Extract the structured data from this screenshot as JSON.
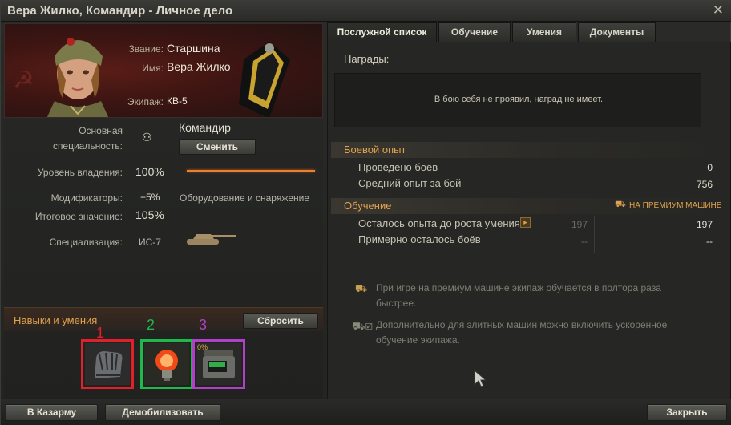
{
  "window": {
    "title": "Вера Жилко, Командир - Личное дело",
    "close_glyph": "✕"
  },
  "profile": {
    "rank_label": "Звание:",
    "rank_value": "Старшина",
    "name_label": "Имя:",
    "name_value": "Вера Жилко",
    "crew_label": "Экипаж:",
    "crew_value": "КВ-5"
  },
  "specialty": {
    "label_line1": "Основная",
    "label_line2": "специальность:",
    "value": "Командир",
    "change_button": "Сменить",
    "icon": "binoculars-icon"
  },
  "mastery": {
    "label": "Уровень владения:",
    "value": "100%",
    "progress": 1.0,
    "bar_color": "#e7822f"
  },
  "modifiers": {
    "label": "Модификаторы:",
    "value": "+5%",
    "source": "Оборудование и снаряжение"
  },
  "total": {
    "label": "Итоговое значение:",
    "value": "105%"
  },
  "specialization": {
    "label": "Специализация:",
    "value": "ИС-7",
    "icon": "tank-silhouette-icon"
  },
  "skills": {
    "title": "Навыки и умения",
    "reset_button": "Сбросить",
    "slots": [
      {
        "number": "1",
        "icon": "gauntlet-icon",
        "border": "#e0202a",
        "badge": ""
      },
      {
        "number": "2",
        "icon": "lightbulb-icon",
        "border": "#1fb84a",
        "badge": ""
      },
      {
        "number": "3",
        "icon": "radio-device-icon",
        "border": "#b040c8",
        "badge": "0%"
      }
    ]
  },
  "tabs": [
    "Послужной список",
    "Обучение",
    "Умения",
    "Документы"
  ],
  "awards": {
    "label": "Награды:",
    "empty_text": "В бою себя не проявил, наград не имеет."
  },
  "combat": {
    "title": "Боевой опыт",
    "battles_label": "Проведено боёв",
    "battles_value": "0",
    "avg_xp_label": "Средний опыт за бой",
    "avg_xp_value": "756"
  },
  "training": {
    "title": "Обучение",
    "premium_label": "НА ПРЕМИУМ МАШИНЕ",
    "xp_left_label": "Осталось опыта до роста умения",
    "xp_left_value": "197",
    "xp_left_premium": "197",
    "battles_left_label": "Примерно осталось боёв",
    "battles_left_value": "--",
    "battles_left_premium": "--"
  },
  "notes": {
    "premium_line1": "При игре на премиум машине экипаж обучается в полтора раза",
    "premium_line2": "быстрее.",
    "elite_line1": "Дополнительно для элитных машин можно включить ускоренное",
    "elite_line2": "обучение экипажа."
  },
  "footer": {
    "barracks_button": "В Казарму",
    "demobilize_button": "Демобилизовать",
    "close_button": "Закрыть"
  }
}
